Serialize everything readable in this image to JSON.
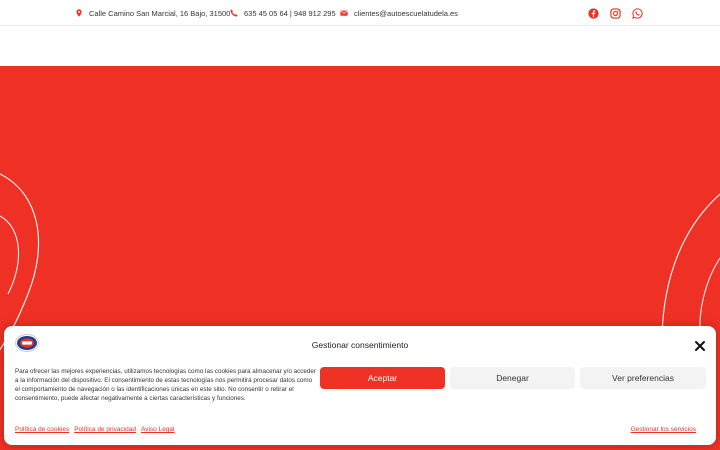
{
  "topbar": {
    "address": "Calle Camino San Marcial, 16 Bajo, 31500",
    "phone": "635 45 05 64 | 948 912 295",
    "email": "clientes@autoescuelatudela.es",
    "icons": {
      "address": "map-pin-icon",
      "phone": "phone-icon",
      "email": "envelope-icon"
    },
    "socials": [
      "facebook-icon",
      "instagram-icon",
      "whatsapp-icon"
    ]
  },
  "colors": {
    "brand": "#ee3124",
    "icon": "#ee3124",
    "button_secondary": "#f3f3f3"
  },
  "consent": {
    "title": "Gestionar consentimiento",
    "text": "Para ofrecer las mejores experiencias, utilizamos tecnologías como las cookies para almacenar y/o acceder a la información del dispositivo. El consentimiento de estas tecnologías nos permitirá procesar datos como el comportamiento de navegación o las identificaciones únicas en este sitio. No consentir o retirar el consentimiento, puede afectar negativamente a ciertas características y funciones.",
    "buttons": {
      "accept": "Aceptar",
      "deny": "Denegar",
      "preferences": "Ver preferencias"
    },
    "links": {
      "cookies": "Política de cookies",
      "privacy": "Política de privacidad",
      "legal": "Aviso Legal",
      "manage": "Gestionar los servicios"
    }
  }
}
